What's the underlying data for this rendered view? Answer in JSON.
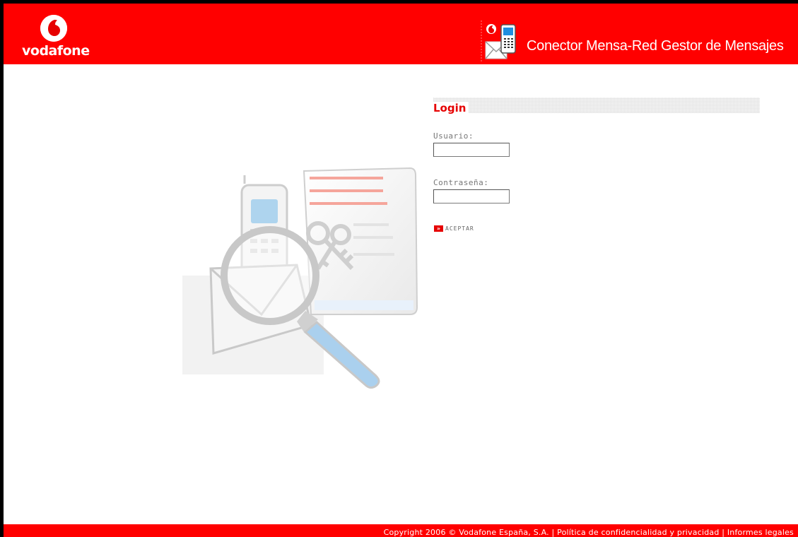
{
  "header": {
    "brand": "vodafone",
    "app_title": "Conector Mensa-Red Gestor de Mensajes",
    "brand_color": "#ff0000"
  },
  "login": {
    "title": "Login",
    "username_label": "Usuario:",
    "username_value": "",
    "password_label": "Contraseña:",
    "password_value": "",
    "submit_label": "ACEPTAR",
    "submit_icon": "double-chevron-right-icon"
  },
  "footer": {
    "copyright": "Copyright 2006 © Vodafone España, S.A.",
    "separator": " | ",
    "privacy_link": "Política de confidencialidad y privacidad",
    "legal_link": "Informes legales"
  },
  "icons": {
    "logo": "vodafone-logo-icon",
    "app": "mobile-mail-icon",
    "illustration": "phone-document-envelope-magnifier-illustration"
  }
}
